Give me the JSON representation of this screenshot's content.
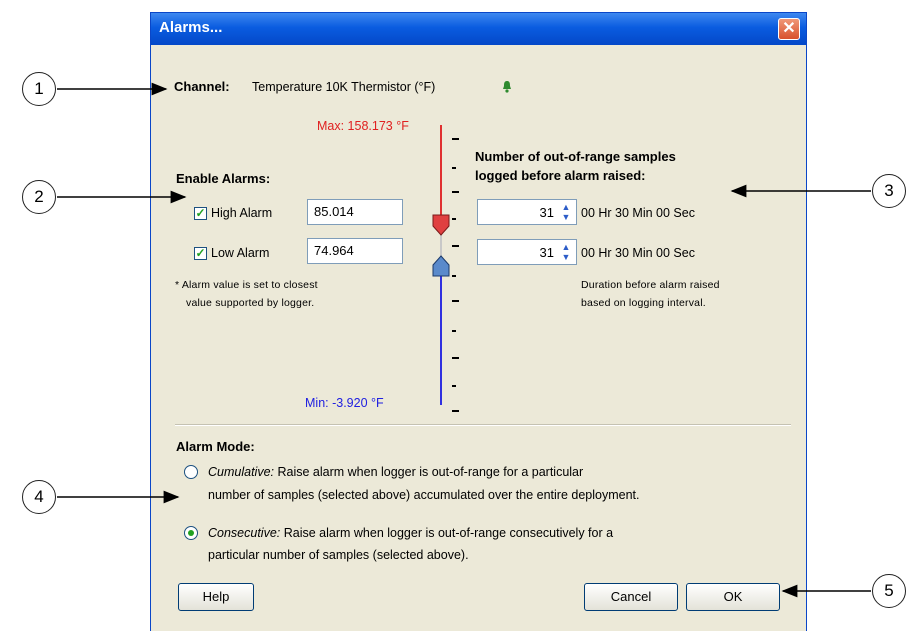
{
  "callouts": [
    "1",
    "2",
    "3",
    "4",
    "5"
  ],
  "window": {
    "title": "Alarms...",
    "close_glyph": "✕"
  },
  "channel": {
    "label": "Channel:",
    "value": "Temperature 10K Thermistor (°F)",
    "icon": "bell-icon"
  },
  "scale": {
    "max_label": "Max: 158.173 °F",
    "min_label": "Min: -3.920 °F",
    "max_color": "#E02020",
    "min_color": "#2020E0"
  },
  "enable": {
    "heading": "Enable Alarms:",
    "high": {
      "label": "High Alarm",
      "checked": true,
      "value": "85.014"
    },
    "low": {
      "label": "Low Alarm",
      "checked": true,
      "value": "74.964"
    },
    "note_line1": "* Alarm value is set to closest",
    "note_line2": "value supported by logger."
  },
  "samples": {
    "heading_line1": "Number of out-of-range samples",
    "heading_line2": "logged before alarm raised:",
    "high": {
      "value": "31",
      "duration": "00 Hr 30 Min 00 Sec"
    },
    "low": {
      "value": "31",
      "duration": "00 Hr 30 Min 00 Sec"
    },
    "note_line1": "Duration before alarm raised",
    "note_line2": "based on logging interval."
  },
  "mode": {
    "heading": "Alarm Mode:",
    "cumulative": {
      "name": "Cumulative:",
      "line1": " Raise alarm when logger is out-of-range for a particular",
      "line2": "number of samples (selected above) accumulated over the entire deployment.",
      "selected": false
    },
    "consecutive": {
      "name": "Consecutive:",
      "line1": " Raise alarm when logger is out-of-range consecutively for a",
      "line2": "particular number of samples (selected above).",
      "selected": true
    }
  },
  "buttons": {
    "help": "Help",
    "cancel": "Cancel",
    "ok": "OK"
  },
  "colors": {
    "titlebar": "#0A5CE0",
    "dialog_bg": "#ECE9D8",
    "check": "#21A121",
    "high_marker": "#E04040",
    "low_marker": "#5A8ACB"
  }
}
